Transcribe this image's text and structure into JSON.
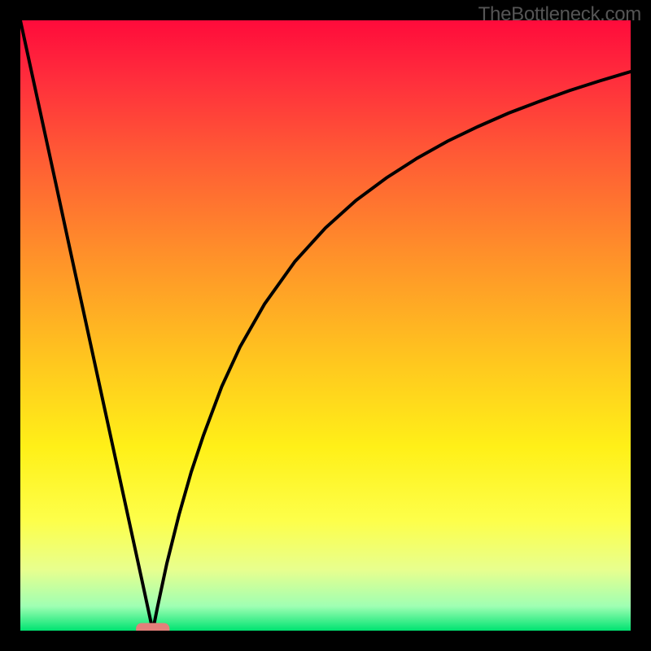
{
  "watermark": "TheBottleneck.com",
  "chart_data": {
    "type": "line",
    "title": "",
    "xlabel": "",
    "ylabel": "",
    "xlim": [
      0,
      100
    ],
    "ylim": [
      0,
      100
    ],
    "grid": false,
    "background_gradient": {
      "direction": "vertical",
      "stops": [
        {
          "pos": 0.0,
          "color": "#ff0b3b"
        },
        {
          "pos": 0.1,
          "color": "#ff2f3c"
        },
        {
          "pos": 0.22,
          "color": "#ff5a35"
        },
        {
          "pos": 0.38,
          "color": "#ff8f2a"
        },
        {
          "pos": 0.55,
          "color": "#ffc41f"
        },
        {
          "pos": 0.7,
          "color": "#fff018"
        },
        {
          "pos": 0.82,
          "color": "#fdff4a"
        },
        {
          "pos": 0.9,
          "color": "#e8ff8e"
        },
        {
          "pos": 0.96,
          "color": "#9fffb3"
        },
        {
          "pos": 1.0,
          "color": "#00e371"
        }
      ]
    },
    "series": [
      {
        "name": "left-branch",
        "x": [
          0.0,
          2.0,
          4.0,
          6.0,
          8.0,
          10.0,
          12.0,
          14.0,
          16.0,
          18.0,
          20.0,
          21.7
        ],
        "values": [
          100.0,
          90.8,
          81.6,
          72.4,
          63.1,
          53.9,
          44.7,
          35.5,
          26.3,
          17.1,
          7.9,
          0.0
        ]
      },
      {
        "name": "right-branch",
        "x": [
          21.7,
          22.5,
          24.0,
          26.0,
          28.0,
          30.0,
          33.0,
          36.0,
          40.0,
          45.0,
          50.0,
          55.0,
          60.0,
          65.0,
          70.0,
          75.0,
          80.0,
          85.0,
          90.0,
          95.0,
          100.0
        ],
        "values": [
          0.0,
          4.0,
          11.0,
          19.0,
          26.0,
          32.0,
          40.0,
          46.5,
          53.5,
          60.5,
          66.0,
          70.5,
          74.2,
          77.4,
          80.2,
          82.6,
          84.8,
          86.7,
          88.5,
          90.1,
          91.6
        ]
      }
    ],
    "marker": {
      "name": "minimum-marker",
      "x": 21.7,
      "y": 0.0,
      "width": 5.5,
      "height": 2.5,
      "color": "#e37f7a"
    }
  }
}
